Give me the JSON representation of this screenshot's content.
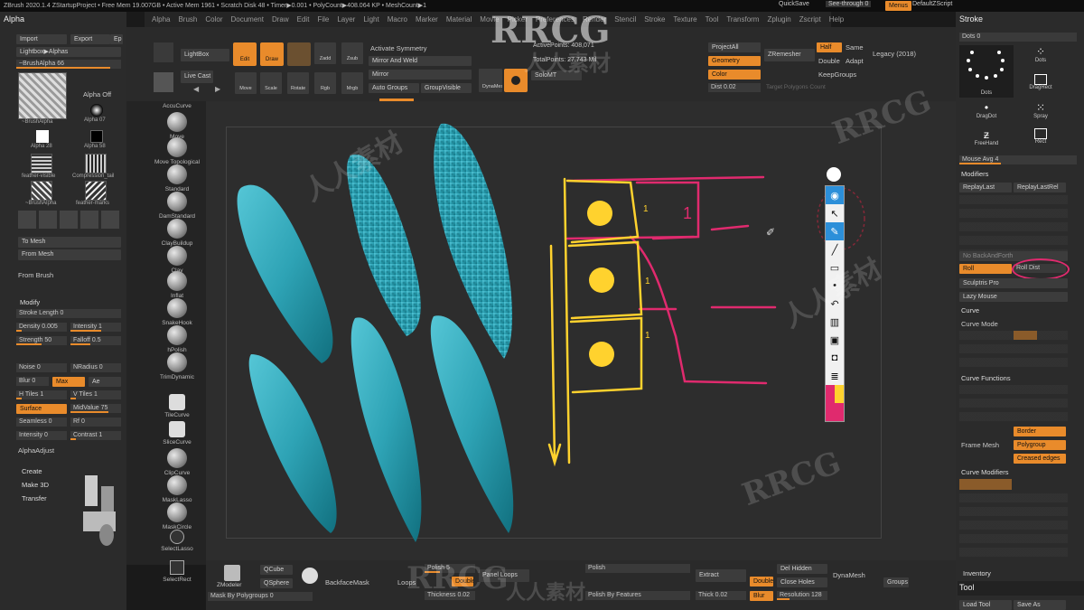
{
  "titlebar": {
    "text": "ZBrush 2020.1.4   ZStartupProject  • Free Mem 19.007GB • Active Mem 1961 • Scratch Disk 48 • Timer▶0.001 • PolyCount▶408.064 KP • MeshCount▶1",
    "quicksave": "QuickSave",
    "seethrough": "See-through  0",
    "menus": "Menus",
    "script": "DefaultZScript"
  },
  "menubar": [
    "Alpha",
    "Brush",
    "Color",
    "Document",
    "Draw",
    "Edit",
    "File",
    "Layer",
    "Light",
    "Macro",
    "Marker",
    "Material",
    "Movie",
    "Picker",
    "Preferences",
    "Render",
    "Stencil",
    "Stroke",
    "Texture",
    "Tool",
    "Transform",
    "Zplugin",
    "Zscript",
    "Help"
  ],
  "left": {
    "title": "Alpha",
    "import": "Import",
    "export": "Export",
    "ep": "Ep",
    "lightbox": "Lightbox▶Alphas",
    "brushalpha": "~BrushAlpha  66",
    "thumbs": [
      "~BrushAlpha",
      "Alpha 07",
      "Alpha 28",
      "Alpha 58",
      "feather-visible",
      "Compression_tail",
      "~BrushAlpha",
      "feather-marks"
    ],
    "alphaoff": "Alpha Off",
    "tomesh": "To Mesh",
    "frommesh": "From Mesh",
    "frombrush": "From Brush",
    "modify": "Modify",
    "sliders": [
      {
        "label": "Stroke Length 0",
        "v": 0
      },
      {
        "label": "Density 0.005",
        "v": 0.1
      },
      {
        "label": "Intensity 1",
        "v": 0.6
      },
      {
        "label": "Strength 50",
        "v": 0.5
      },
      {
        "label": "Falloff 0.5",
        "v": 0.4
      },
      {
        "label": "Noise 0",
        "v": 0
      },
      {
        "label": "NRadius 0",
        "v": 0
      },
      {
        "label": "Blur 0",
        "v": 0
      },
      {
        "label": "Max",
        "v": 1
      },
      {
        "label": "Ae",
        "v": 0
      },
      {
        "label": "H Tiles 1",
        "v": 0.1
      },
      {
        "label": "V Tiles 1",
        "v": 0.1
      },
      {
        "label": "Surface",
        "v": 1
      },
      {
        "label": "MidValue 75",
        "v": 0.75
      },
      {
        "label": "Seamless 0",
        "v": 0
      },
      {
        "label": "Rf 0",
        "v": 0
      },
      {
        "label": "Intensity 0",
        "v": 0
      },
      {
        "label": "Contrast 1",
        "v": 0.1
      }
    ],
    "alphaadjust": "AlphaAdjust",
    "create": "Create",
    "make3d": "Make 3D",
    "transfer": "Transfer"
  },
  "toolbar": {
    "lightbox": "LightBox",
    "livecast": "Live Cast",
    "edit": "Edit",
    "draw": "Draw",
    "move": "Move",
    "scale": "Scale",
    "rotate": "Rotate",
    "zadd": "Zadd",
    "zsub": "Zsub",
    "zcut": "Zcut",
    "rgb": "Rgb",
    "mrgb": "Mrgb",
    "m": "M",
    "symmetry": "Activate Symmetry",
    "mirrorweld": "Mirror And Weld",
    "mirror": "Mirror",
    "autogroups": "Auto Groups",
    "groupvisible": "GroupVisible",
    "activepoints": "ActivePoints: 408,071",
    "totalpoints": "TotalPoints: 27.743 Mil",
    "dynamesh": "DynaMesh",
    "solomt": "SoloMT",
    "projectall": "ProjectAll",
    "zremesher": "ZRemesher",
    "half": "Half",
    "same": "Same",
    "geometry": "Geometry",
    "double": "Double",
    "adapt": "Adapt",
    "color": "Color",
    "keepgroups": "KeepGroups",
    "legacy": "Legacy (2018)",
    "dist": "Dist 0.02",
    "targetpoly": "Target Polygons Count"
  },
  "brushes": [
    "AccuCurve",
    "Move",
    "Move Topological",
    "Standard",
    "DamStandard",
    "ClayBuildup",
    "Clay",
    "Inflat",
    "SnakeHook",
    "hPolish",
    "TrimDynamic",
    "TileCurve",
    "SliceCurve",
    "ClipCurve",
    "MaskLasso",
    "MaskCircle",
    "SelectLasso",
    "SelectRect"
  ],
  "right": {
    "stroke": "Stroke",
    "dots": "Dots  0",
    "strokes": [
      "Dots",
      "Dots",
      "Dots",
      "DragRect",
      "DragDot",
      "Spray",
      "FreeHand",
      "Rect"
    ],
    "mouseavg": "Mouse Avg 4",
    "modifiers": "Modifiers",
    "replaylast": "ReplayLast",
    "replaylastrel": "ReplayLastRel",
    "roll": "Roll",
    "rolldist": "Roll Dist",
    "nobackforth": "No BackAndForth",
    "sculptris": "Sculptris Pro",
    "lazymouse": "Lazy Mouse",
    "curve": "Curve",
    "curvemode": "Curve Mode",
    "curvefunctions": "Curve Functions",
    "framemesh": "Frame Mesh",
    "border": "Border",
    "polygroup": "Polygroup",
    "creased": "Creased edges",
    "curvemodifiers": "Curve Modifiers",
    "inventory": "Inventory",
    "tool": "Tool",
    "loadtool": "Load Tool",
    "saveas": "Save As"
  },
  "bottom": {
    "zmodeler": "ZModeler",
    "qcube": "QCube",
    "qsphere": "QSphere",
    "backfacemask": "BackfaceMask",
    "maskbypoly": "Mask By Polygroups 0",
    "polish5": "Polish 5",
    "loops": "Loops",
    "double": "Double",
    "thickness": "Thickness 0.02",
    "panelloops": "Panel Loops",
    "polish": "Polish",
    "polishbyfeatures": "Polish By Features",
    "extract": "Extract",
    "thick": "Thick 0.02",
    "delhidden": "Del Hidden",
    "closeholes": "Close Holes",
    "resolution": "Resolution 128",
    "dynamesh": "DynaMesh",
    "groups": "Groups",
    "blur": "Blur"
  },
  "drawing": {
    "label1": "1",
    "tick1": "1",
    "tick2": "1",
    "tick3": "1"
  },
  "watermarks": [
    "RRCG",
    "人人素材"
  ],
  "colors": {
    "accent": "#e98b2b",
    "mesh": "#3fb3c4",
    "pink": "#e02a6e",
    "yellow": "#ffd22e"
  }
}
